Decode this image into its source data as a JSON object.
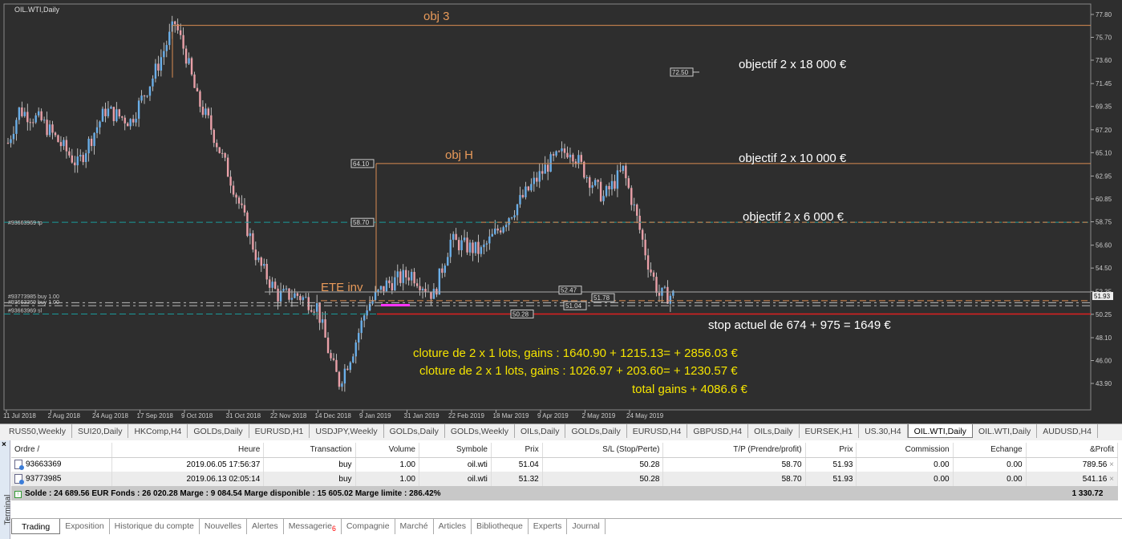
{
  "chart": {
    "symbol": "OIL.WTI,Daily",
    "price_axis": [
      "77.80",
      "75.70",
      "73.60",
      "71.45",
      "69.35",
      "67.20",
      "65.10",
      "62.95",
      "60.85",
      "58.75",
      "56.60",
      "54.50",
      "52.35",
      "50.25",
      "48.10",
      "46.00",
      "43.90"
    ],
    "current_price": "51.93",
    "date_axis": [
      "11 Jul 2018",
      "2 Aug 2018",
      "24 Aug 2018",
      "17 Sep 2018",
      "9 Oct 2018",
      "31 Oct 2018",
      "22 Nov 2018",
      "14 Dec 2018",
      "9 Jan 2019",
      "31 Jan 2019",
      "22 Feb 2019",
      "18 Mar 2019",
      "9 Apr 2019",
      "2 May 2019",
      "24 May 2019"
    ],
    "price_path": [
      [
        0,
        66
      ],
      [
        4,
        69
      ],
      [
        12,
        68
      ],
      [
        25,
        64
      ],
      [
        35,
        69
      ],
      [
        44,
        68
      ],
      [
        52,
        72
      ],
      [
        60,
        77
      ],
      [
        64,
        74
      ],
      [
        68,
        70
      ],
      [
        72,
        68
      ],
      [
        81,
        62
      ],
      [
        90,
        55
      ],
      [
        97,
        52
      ],
      [
        104,
        52
      ],
      [
        111,
        51
      ],
      [
        116,
        46
      ],
      [
        119,
        44
      ],
      [
        124,
        47
      ],
      [
        129,
        51
      ],
      [
        136,
        53
      ],
      [
        145,
        54
      ],
      [
        153,
        52
      ],
      [
        159,
        57
      ],
      [
        170,
        56
      ],
      [
        179,
        59
      ],
      [
        188,
        62
      ],
      [
        194,
        64
      ],
      [
        202,
        65.5
      ],
      [
        208,
        63
      ],
      [
        214,
        61
      ],
      [
        221,
        63.5
      ],
      [
        225,
        60
      ],
      [
        230,
        55
      ],
      [
        234,
        52
      ],
      [
        240,
        52
      ]
    ],
    "labels": {
      "obj3": "obj 3",
      "objH": "obj H",
      "ete": "ETE inv",
      "p7250": "72.50",
      "p6410": "64.10",
      "p5870": "58.70",
      "p5247": "52.47",
      "p5178": "51.78",
      "p5104": "51.04",
      "p5028": "50.28"
    },
    "order_lines": {
      "tp": "#93663969 tp",
      "buy1": "#93773985 buy 1.00",
      "buy2": "#93663369 buy 1.00",
      "sl": "#93663969 sl"
    },
    "annotations": {
      "obj18": "objectif 2 x 18 000 €",
      "obj10": "objectif 2 x 10 000 €",
      "obj6": "objectif 2 x 6 000 €",
      "stop": "stop actuel de 674 + 975 = 1649 €",
      "close1": "cloture de  2 x 1 lots, gains : 1640.90 + 1215.13= + 2856.03 €",
      "close2": "cloture de  2 x 1 lots, gains : 1026.97 + 203.60= + 1230.57 €",
      "total": "total gains + 4086.6 €"
    },
    "colors": {
      "up": "#6aaee8",
      "down": "#e9a0a8",
      "objline": "#d98c52",
      "sl": "#e02020",
      "tp": "#1a9a9a"
    }
  },
  "chart_tabs": [
    "RUS50,Weekly",
    "SUI20,Daily",
    "HKComp,H4",
    "GOLDs,Daily",
    "EURUSD,H1",
    "USDJPY,Weekly",
    "GOLDs,Daily",
    "GOLDs,Weekly",
    "OILs,Daily",
    "GOLDs,Daily",
    "EURUSD,H4",
    "GBPUSD,H4",
    "OILs,Daily",
    "EURSEK,H1",
    "US.30,H4",
    "OIL.WTI,Daily",
    "OIL.WTI,Daily",
    "AUDUSD,H4"
  ],
  "terminal": {
    "label": "Terminal",
    "columns": [
      "Ordre  /",
      "Heure",
      "Transaction",
      "Volume",
      "Symbole",
      "Prix",
      "S/L (Stop/Perte)",
      "T/P (Prendre/profit)",
      "Prix",
      "Commission",
      "Echange",
      "&Profit"
    ],
    "rows": [
      [
        "93663369",
        "2019.06.05 17:56:37",
        "buy",
        "1.00",
        "oil.wti",
        "51.04",
        "50.28",
        "58.70",
        "51.93",
        "0.00",
        "0.00",
        "789.56"
      ],
      [
        "93773985",
        "2019.06.13 02:05:14",
        "buy",
        "1.00",
        "oil.wti",
        "51.32",
        "50.28",
        "58.70",
        "51.93",
        "0.00",
        "0.00",
        "541.16"
      ]
    ],
    "summary": "Solde : 24 689.56 EUR  Fonds : 26 020.28  Marge : 9 084.54  Marge disponible : 15 605.02  Marge limite : 286.42%",
    "total_profit": "1 330.72",
    "tabs": [
      "Trading",
      "Exposition",
      "Historique du compte",
      "Nouvelles",
      "Alertes",
      "Messagerie",
      "Compagnie",
      "Marché",
      "Articles",
      "Bibliotheque",
      "Experts",
      "Journal"
    ],
    "messagerie_badge": "6"
  }
}
